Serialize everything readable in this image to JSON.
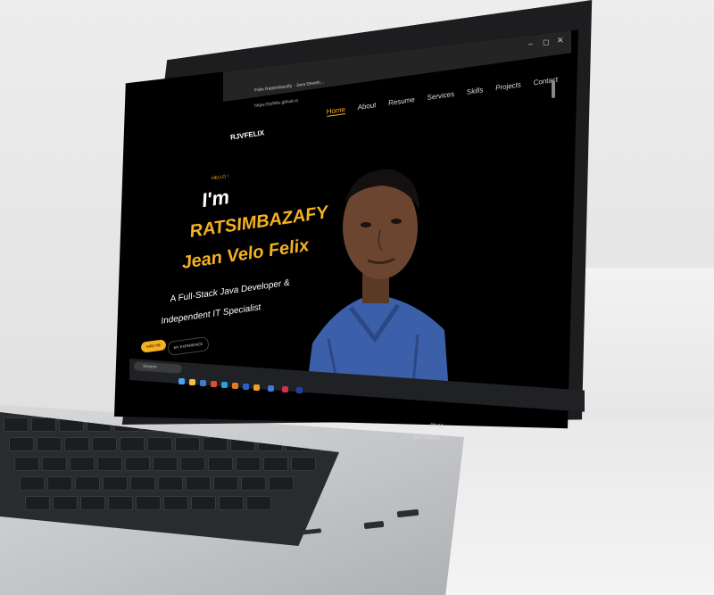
{
  "browser": {
    "tab_title": "Felix Ratsimbazafy · Java Develo...",
    "url": "https://rjvfelix.github.io",
    "window_controls": [
      "–",
      "◻",
      "✕"
    ]
  },
  "site": {
    "brand": "RJVFELIX",
    "nav": [
      "Home",
      "About",
      "Resume",
      "Services",
      "Skills",
      "Projects",
      "Contact"
    ],
    "active_nav": "Home",
    "hero": {
      "greeting": "HELLO !",
      "intro": "I'm",
      "name_line1": "RATSIMBAZAFY",
      "name_line2": "Jean Velo Felix",
      "desc_line1": "A Full-Stack Java Developer &",
      "desc_line2": "Independent IT Specialist",
      "button_hire": "HIRE ME",
      "button_experience": "MY EXPERIENCE"
    }
  },
  "taskbar": {
    "search_placeholder": "Search",
    "time": "09:11",
    "date": "16/11/2024"
  },
  "colors": {
    "accent": "#f5b120",
    "screen_bg": "#000000",
    "shirt": "#3b5fa8"
  }
}
